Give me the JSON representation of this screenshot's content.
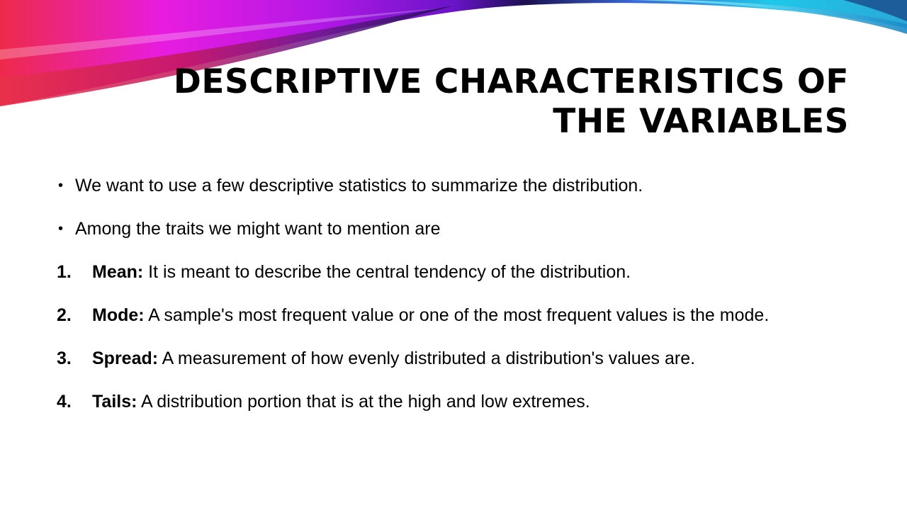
{
  "slide": {
    "title_line1": "DESCRIPTIVE CHARACTERISTICS OF",
    "title_line2": "THE VARIABLES",
    "bullets": [
      {
        "marker": "•",
        "text": "We want to use a few descriptive statistics to summarize the distribution."
      },
      {
        "marker": "•",
        "text": "Among the traits we might want to mention are"
      }
    ],
    "numbered": [
      {
        "marker": "1.",
        "term": "Mean:",
        "text": " It is meant to describe the central tendency of the distribution."
      },
      {
        "marker": "2.",
        "term": "Mode:",
        "text": " A sample's most frequent value or one of the most frequent values is the mode."
      },
      {
        "marker": "3.",
        "term": "Spread:",
        "text": " A measurement of how evenly distributed a distribution's values are."
      },
      {
        "marker": "4.",
        "term": "Tails:",
        "text": " A distribution portion that is at the high and low extremes."
      }
    ]
  },
  "colors": {
    "magenta": "#e81ce0",
    "purple": "#8a1fd8",
    "red": "#e8324a",
    "navy": "#1a1050",
    "cyan": "#1ec8e8"
  }
}
